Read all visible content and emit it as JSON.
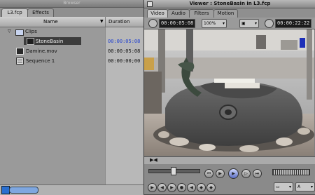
{
  "browser": {
    "window_title": "Browser",
    "tabs": [
      {
        "label": "L3.fcp"
      },
      {
        "label": "Effects"
      }
    ],
    "columns": {
      "name": "Name",
      "duration": "Duration"
    },
    "items": [
      {
        "name": "Clips",
        "duration": "",
        "type": "bin"
      },
      {
        "name": "StoneBasin",
        "duration": "00:00:05:08",
        "type": "clip"
      },
      {
        "name": "Damine.mov",
        "duration": "00:00:05:08",
        "type": "clip"
      },
      {
        "name": "Sequence 1",
        "duration": "00:00:00;00",
        "type": "sequence"
      }
    ]
  },
  "viewer": {
    "window_title": "Viewer : StoneBasin in L3.fcp",
    "tabs": [
      {
        "label": "Video"
      },
      {
        "label": "Audio"
      },
      {
        "label": "Filters"
      },
      {
        "label": "Motion"
      }
    ],
    "duration_timecode": "00:00:05:08",
    "zoom": "100%",
    "current_timecode": "00:00:22:22"
  },
  "colors": {
    "accent_blue": "#2040d0",
    "scroll_blue": "#2a6fd0"
  }
}
